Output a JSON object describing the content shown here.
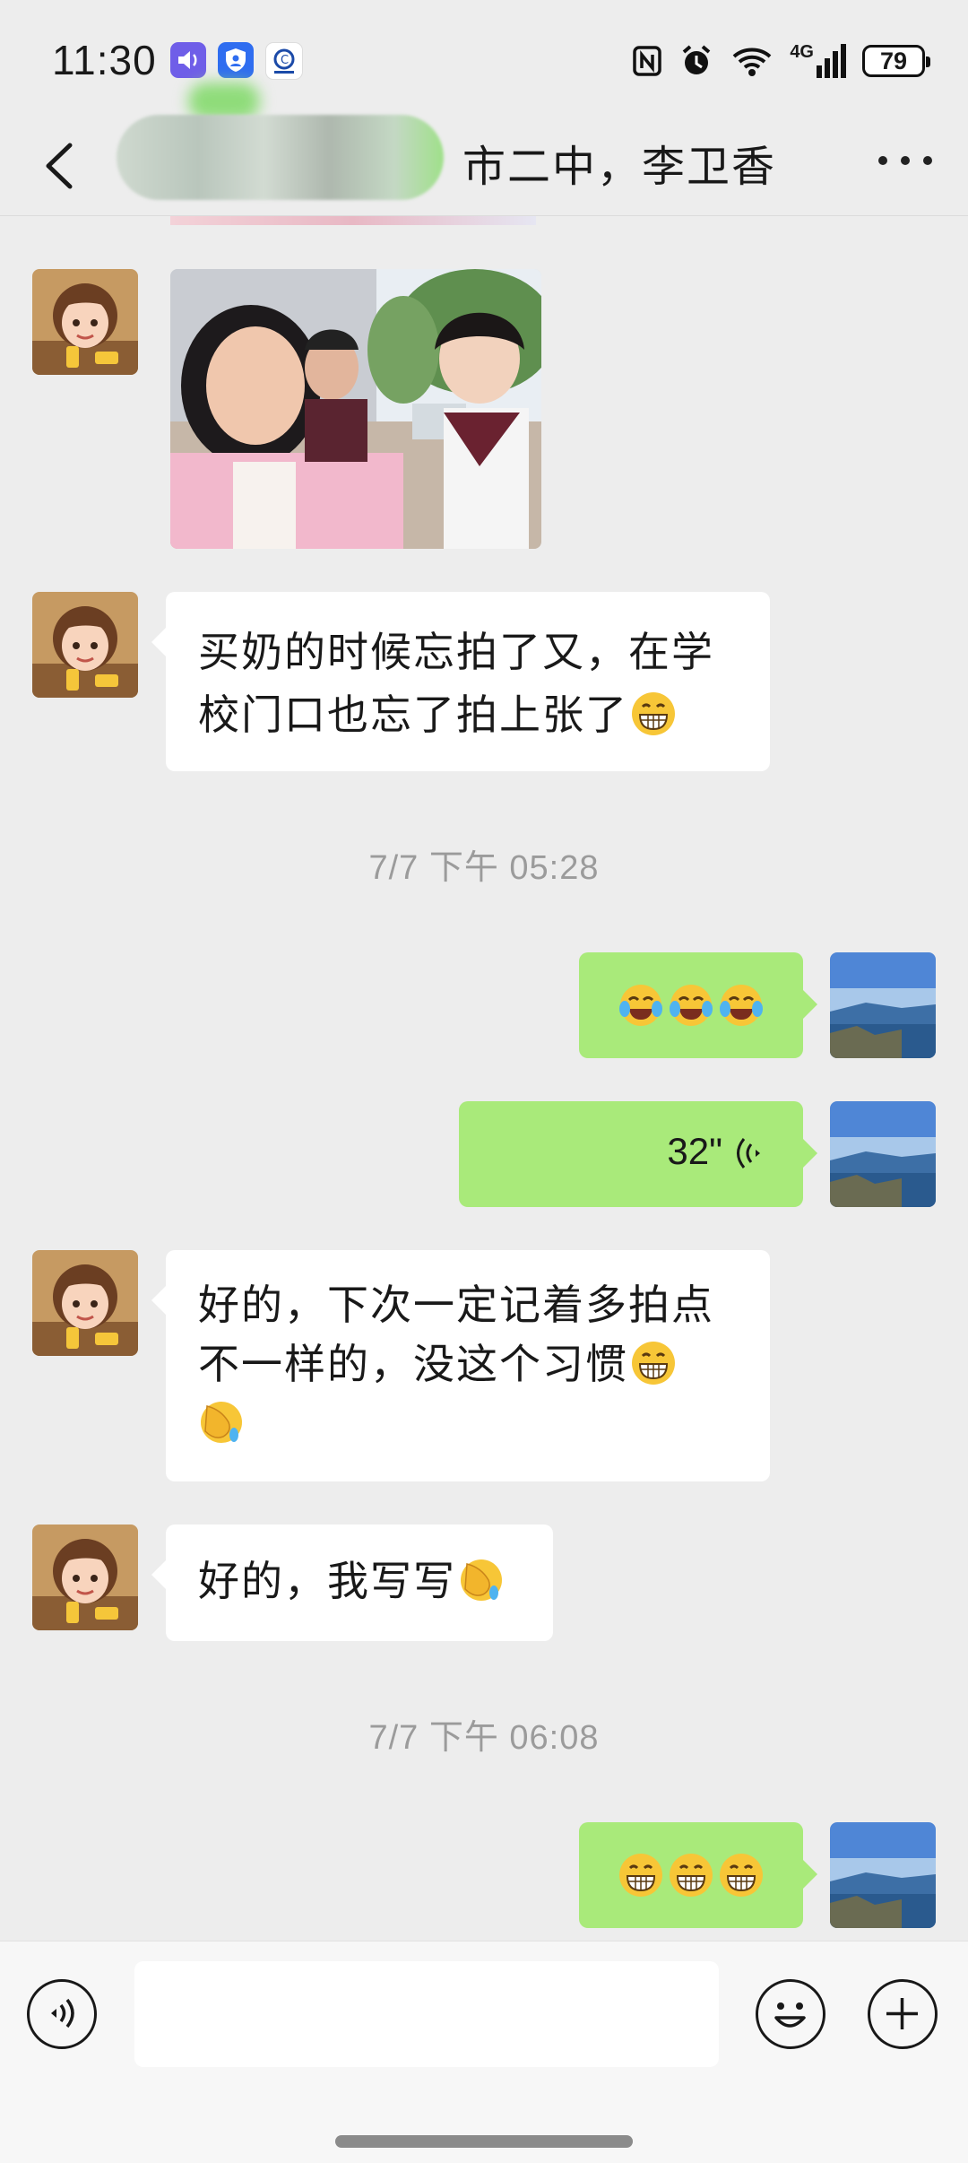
{
  "status_bar": {
    "time": "11:30",
    "network": "4G",
    "battery": "79"
  },
  "header": {
    "title": "市二中，李卫香"
  },
  "messages": {
    "m2_text": "买奶的时候忘拍了又，在学校门口也忘了拍上张了",
    "time1": "7/7 下午 05:28",
    "voice_duration": "32\"",
    "m5_line1": "好的，下次一定记着多拍点",
    "m5_line2": "不一样的，没这个习惯",
    "m6_text": "好的，我写写",
    "time2": "7/7 下午 06:08"
  },
  "colors": {
    "background": "#ededed",
    "bubble_self": "#a9ea7a",
    "bubble_other": "#ffffff",
    "timestamp": "#9b9b9b"
  },
  "icons": [
    "back-arrow-icon",
    "more-icon",
    "voice-mode-icon",
    "emoji-icon",
    "plus-icon",
    "voice-wave-icon",
    "nfc-icon",
    "alarm-icon",
    "wifi-icon",
    "signal-icon"
  ]
}
